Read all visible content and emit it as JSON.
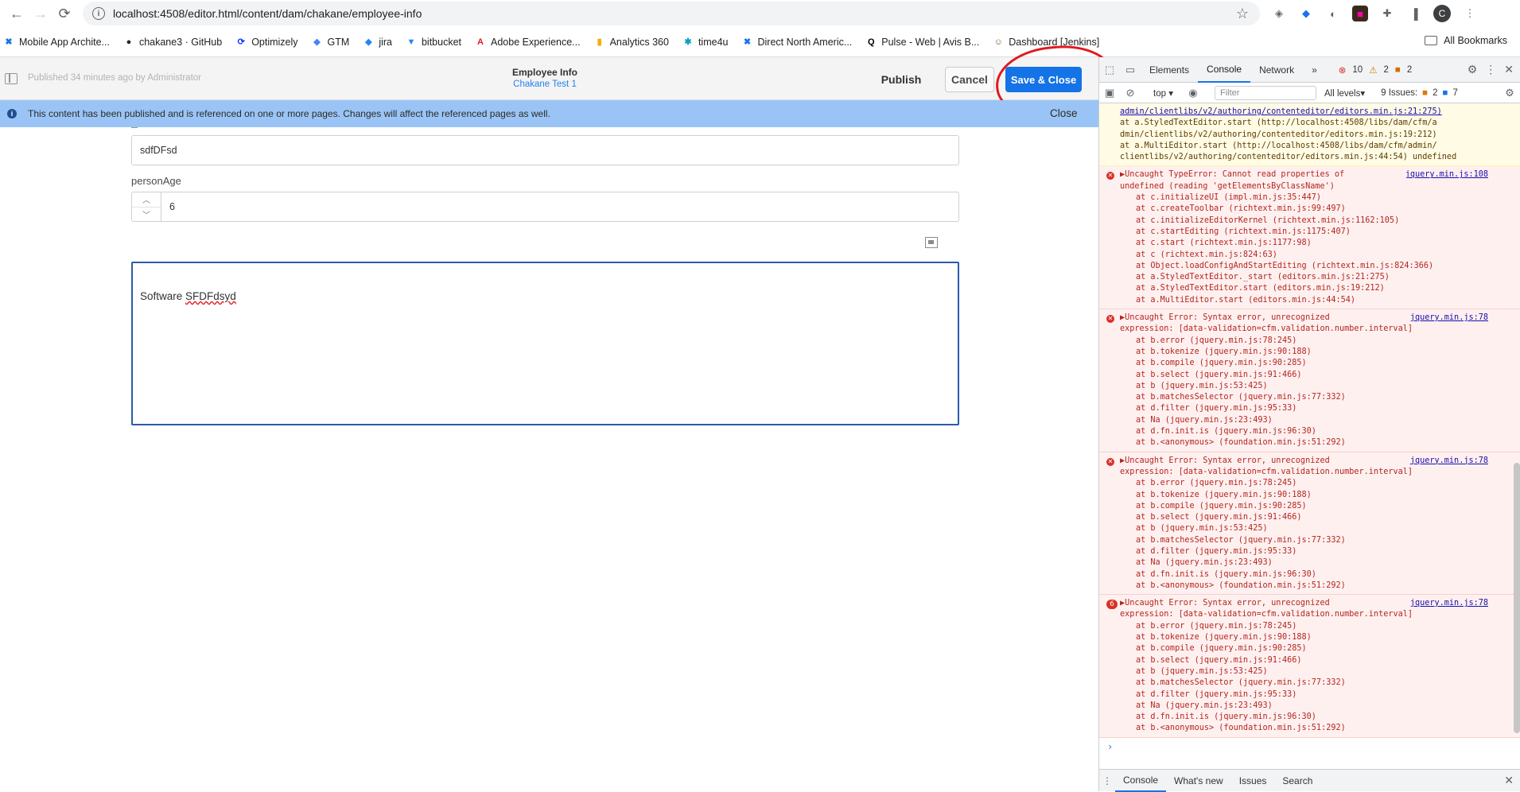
{
  "browser": {
    "url": "localhost:4508/editor.html/content/dam/chakane/employee-info",
    "avatar_letter": "C",
    "bookmarks": [
      {
        "label": "Mobile App Archite...",
        "icon": "✖",
        "color": "#1a73e8"
      },
      {
        "label": "chakane3 · GitHub",
        "icon": "●",
        "color": "#24292f"
      },
      {
        "label": "Optimizely",
        "icon": "⟳",
        "color": "#0037ff"
      },
      {
        "label": "GTM",
        "icon": "◆",
        "color": "#4285f4"
      },
      {
        "label": "jira",
        "icon": "◆",
        "color": "#2684ff"
      },
      {
        "label": "bitbucket",
        "icon": "▼",
        "color": "#2684ff"
      },
      {
        "label": "Adobe Experience...",
        "icon": "A",
        "color": "#e0191f"
      },
      {
        "label": "Analytics 360",
        "icon": "▮",
        "color": "#f9ab00"
      },
      {
        "label": "time4u",
        "icon": "✱",
        "color": "#00a3bf"
      },
      {
        "label": "Direct North Americ...",
        "icon": "✖",
        "color": "#1a73e8"
      },
      {
        "label": "Pulse - Web | Avis B...",
        "icon": "Q",
        "color": "#000000"
      },
      {
        "label": "Dashboard [Jenkins]",
        "icon": "☺",
        "color": "#8a5a2b"
      }
    ],
    "all_bookmarks": "All Bookmarks"
  },
  "editor": {
    "published_text": "Published 34 minutes ago by Administrator",
    "title": "Employee Info",
    "subtitle": "Chakane Test 1",
    "publish_label": "Publish",
    "cancel_label": "Cancel",
    "save_label": "Save & Close",
    "banner_text": "This content has been published and is referenced on one or more pages. Changes will affect the referenced pages as well.",
    "banner_close": "Close",
    "fields": {
      "name_value": "sdfDFsd",
      "age_label": "personAge",
      "age_value": "6",
      "rte_prefix": "Software ",
      "rte_misspelled": "SFDFdsyd"
    }
  },
  "devtools": {
    "tabs": [
      "Elements",
      "Console",
      "Network"
    ],
    "active_tab": "Console",
    "more": "»",
    "error_count": "10",
    "warn_count": "2",
    "issue_count": "2",
    "context": "top",
    "filter_placeholder": "Filter",
    "levels": "All levels",
    "issues_label": "9 Issues:",
    "issues_orange": "2",
    "issues_blue": "7",
    "drawer_tabs": [
      "Console",
      "What's new",
      "Issues",
      "Search"
    ],
    "messages": [
      {
        "type": "warn",
        "head": "admin/clientlibs/v2/authoring/contenteditor/editors.min.js:21:275)",
        "lines": [
          "at a.StyledTextEditor.start (http://localhost:4508/libs/dam/cfm/a",
          "dmin/clientlibs/v2/authoring/contenteditor/editors.min.js:19:212)",
          "at a.MultiEditor.start (http://localhost:4508/libs/dam/cfm/admin/",
          "clientlibs/v2/authoring/contenteditor/editors.min.js:44:54) undefined"
        ]
      },
      {
        "type": "err",
        "source": "jquery.min.js:108",
        "head": "▶Uncaught TypeError: Cannot read properties of\nundefined (reading 'getElementsByClassName')",
        "lines": [
          "at c.initializeUI (impl.min.js:35:447)",
          "at c.createToolbar (richtext.min.js:99:497)",
          "at c.initializeEditorKernel (richtext.min.js:1162:105)",
          "at c.startEditing (richtext.min.js:1175:407)",
          "at c.start (richtext.min.js:1177:98)",
          "at c (richtext.min.js:824:63)",
          "at Object.loadConfigAndStartEditing (richtext.min.js:824:366)",
          "at a.StyledTextEditor._start (editors.min.js:21:275)",
          "at a.StyledTextEditor.start (editors.min.js:19:212)",
          "at a.MultiEditor.start (editors.min.js:44:54)"
        ]
      },
      {
        "type": "err",
        "source": "jquery.min.js:78",
        "head": "▶Uncaught Error: Syntax error, unrecognized\nexpression: [data-validation=cfm.validation.number.interval]",
        "lines": [
          "at b.error (jquery.min.js:78:245)",
          "at b.tokenize (jquery.min.js:90:188)",
          "at b.compile (jquery.min.js:90:285)",
          "at b.select (jquery.min.js:91:466)",
          "at b (jquery.min.js:53:425)",
          "at b.matchesSelector (jquery.min.js:77:332)",
          "at d.filter (jquery.min.js:95:33)",
          "at Na (jquery.min.js:23:493)",
          "at d.fn.init.is (jquery.min.js:96:30)",
          "at b.<anonymous> (foundation.min.js:51:292)"
        ]
      },
      {
        "type": "err",
        "source": "jquery.min.js:78",
        "head": "▶Uncaught Error: Syntax error, unrecognized\nexpression: [data-validation=cfm.validation.number.interval]",
        "lines": [
          "at b.error (jquery.min.js:78:245)",
          "at b.tokenize (jquery.min.js:90:188)",
          "at b.compile (jquery.min.js:90:285)",
          "at b.select (jquery.min.js:91:466)",
          "at b (jquery.min.js:53:425)",
          "at b.matchesSelector (jquery.min.js:77:332)",
          "at d.filter (jquery.min.js:95:33)",
          "at Na (jquery.min.js:23:493)",
          "at d.fn.init.is (jquery.min.js:96:30)",
          "at b.<anonymous> (foundation.min.js:51:292)"
        ]
      },
      {
        "type": "err",
        "count": "6",
        "source": "jquery.min.js:78",
        "head": "▶Uncaught Error: Syntax error, unrecognized\nexpression: [data-validation=cfm.validation.number.interval]",
        "lines": [
          "at b.error (jquery.min.js:78:245)",
          "at b.tokenize (jquery.min.js:90:188)",
          "at b.compile (jquery.min.js:90:285)",
          "at b.select (jquery.min.js:91:466)",
          "at b (jquery.min.js:53:425)",
          "at b.matchesSelector (jquery.min.js:77:332)",
          "at d.filter (jquery.min.js:95:33)",
          "at Na (jquery.min.js:23:493)",
          "at d.fn.init.is (jquery.min.js:96:30)",
          "at b.<anonymous> (foundation.min.js:51:292)"
        ]
      }
    ]
  }
}
